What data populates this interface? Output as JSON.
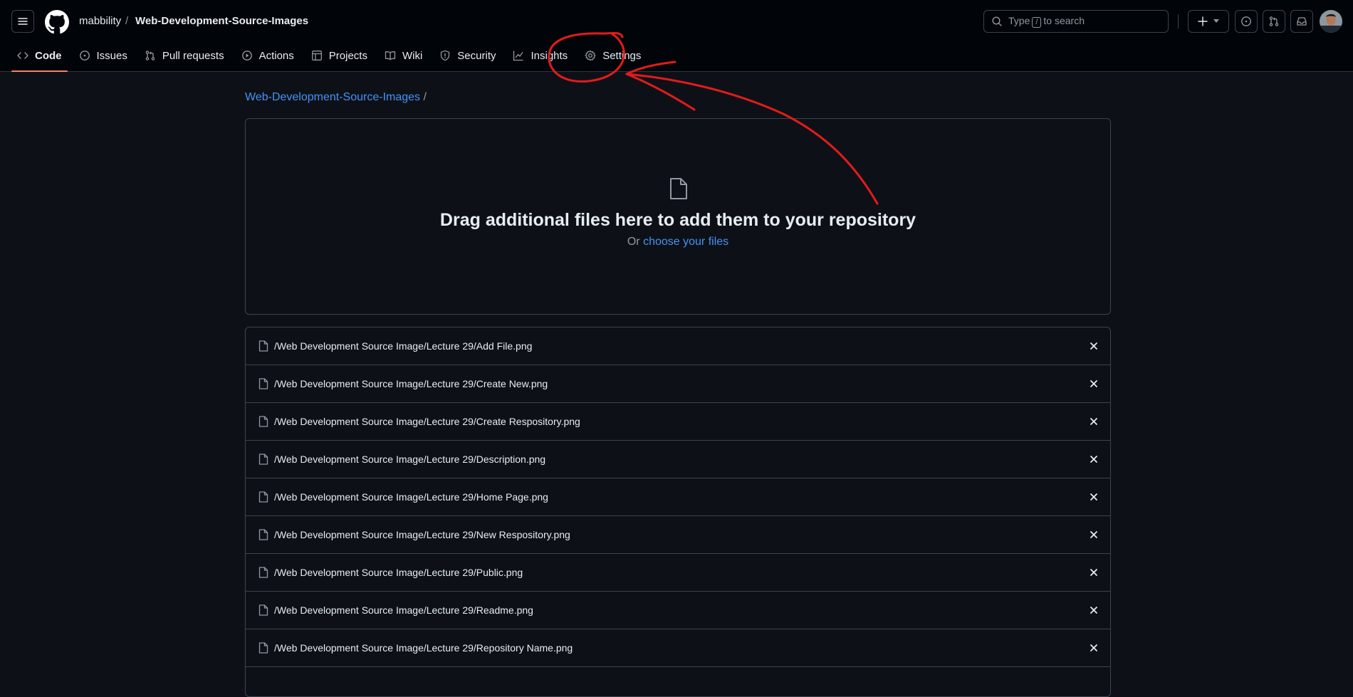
{
  "header": {
    "owner": "mabbility",
    "separator": "/",
    "repo": "Web-Development-Source-Images",
    "search": {
      "prefix": "Type",
      "key": "/",
      "suffix": "to search"
    }
  },
  "tabs": [
    {
      "label": "Code",
      "icon": "code-icon"
    },
    {
      "label": "Issues",
      "icon": "issue-icon"
    },
    {
      "label": "Pull requests",
      "icon": "pull-request-icon"
    },
    {
      "label": "Actions",
      "icon": "play-icon"
    },
    {
      "label": "Projects",
      "icon": "table-icon"
    },
    {
      "label": "Wiki",
      "icon": "book-icon"
    },
    {
      "label": "Security",
      "icon": "shield-icon"
    },
    {
      "label": "Insights",
      "icon": "graph-icon"
    },
    {
      "label": "Settings",
      "icon": "gear-icon"
    }
  ],
  "breadcrumb": {
    "repo": "Web-Development-Source-Images",
    "sep": "/"
  },
  "dropzone": {
    "title": "Drag additional files here to add them to your repository",
    "or": "Or",
    "link": "choose your files"
  },
  "files": [
    "/Web Development Source Image/Lecture 29/Add File.png",
    "/Web Development Source Image/Lecture 29/Create New.png",
    "/Web Development Source Image/Lecture 29/Create Respository.png",
    "/Web Development Source Image/Lecture 29/Description.png",
    "/Web Development Source Image/Lecture 29/Home Page.png",
    "/Web Development Source Image/Lecture 29/New Respository.png",
    "/Web Development Source Image/Lecture 29/Public.png",
    "/Web Development Source Image/Lecture 29/Readme.png",
    "/Web Development Source Image/Lecture 29/Repository Name.png"
  ],
  "colors": {
    "background": "#0d1117",
    "header": "#010409",
    "link": "#4493f8",
    "active_tab": "#f78166",
    "annotation": "#e31b1b"
  }
}
